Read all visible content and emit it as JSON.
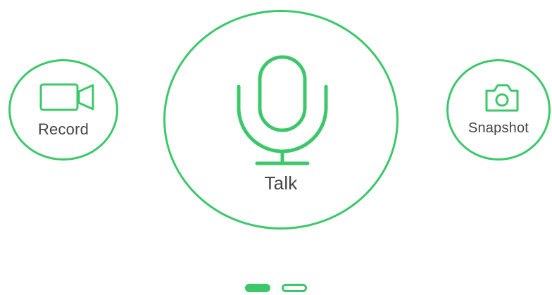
{
  "actions": {
    "record": {
      "label": "Record",
      "icon": "video-camera-icon"
    },
    "talk": {
      "label": "Talk",
      "icon": "microphone-icon"
    },
    "snapshot": {
      "label": "Snapshot",
      "icon": "camera-icon"
    }
  },
  "pager": {
    "count": 2,
    "active_index": 0
  },
  "colors": {
    "accent": "#3cc86a",
    "text": "#444444",
    "background": "#ffffff"
  }
}
